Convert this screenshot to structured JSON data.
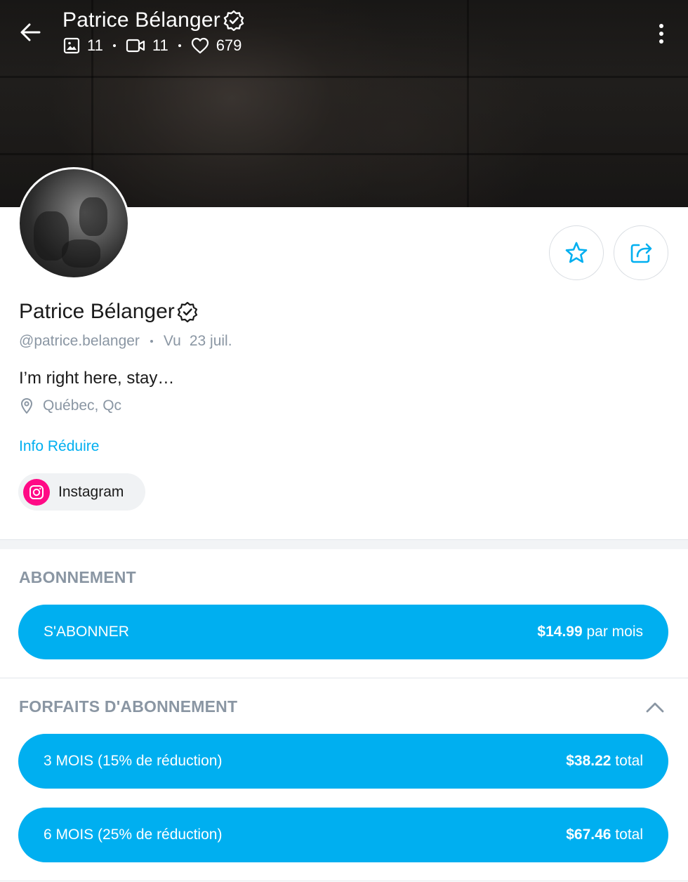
{
  "header": {
    "name": "Patrice Bélanger",
    "stats": {
      "photos": "11",
      "videos": "11",
      "likes": "679"
    }
  },
  "profile": {
    "name": "Patrice Bélanger",
    "handle": "@patrice.belanger",
    "seen_label": "Vu",
    "seen_date": "23 juil.",
    "bio": "I’m right here, stay…",
    "location": "Québec, Qc",
    "info_link": "Info Réduire",
    "social": {
      "label": "Instagram"
    }
  },
  "subscription": {
    "title": "ABONNEMENT",
    "button_label": "S'ABONNER",
    "price": "$14.99",
    "price_suffix": " par mois"
  },
  "bundles": {
    "title": "FORFAITS D'ABONNEMENT",
    "items": [
      {
        "label": "3 MOIS (15% de réduction)",
        "price": "$38.22",
        "suffix": " total"
      },
      {
        "label": "6 MOIS (25% de réduction)",
        "price": "$67.46",
        "suffix": " total"
      }
    ]
  },
  "colors": {
    "accent": "#00aff0",
    "muted_text": "#8a96a3",
    "instagram": "#ff0a86"
  }
}
